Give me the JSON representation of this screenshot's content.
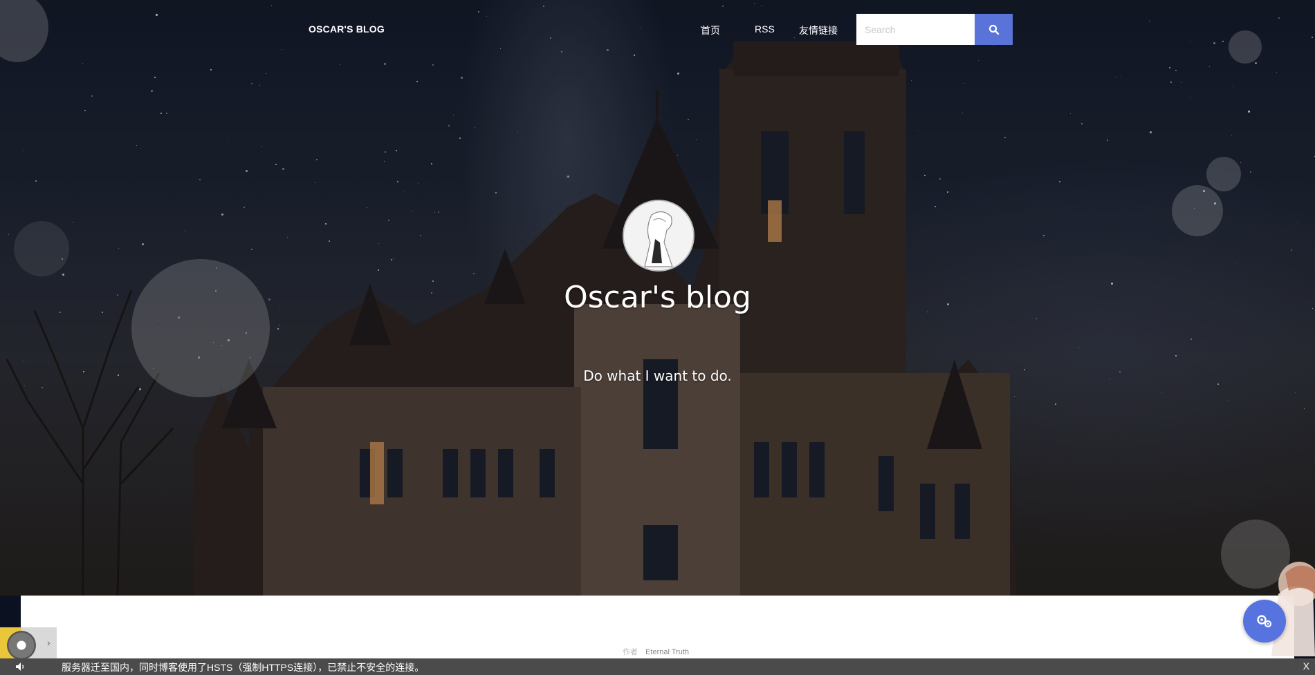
{
  "nav": {
    "brand": "OSCAR'S BLOG",
    "links": [
      {
        "label": "首页"
      },
      {
        "label": "RSS"
      },
      {
        "label": "友情链接"
      }
    ],
    "search": {
      "placeholder": "Search"
    },
    "search_icon": "search-icon",
    "accent_color": "#5a73d8"
  },
  "header": {
    "title": "Oscar's blog",
    "tagline": "Do what I want to do."
  },
  "footer": {
    "author_prefix": "作者",
    "author_name": "Eternal Truth"
  },
  "notice": {
    "text": "服务器迁至国内，同时博客使用了HSTS（强制HTTPS连接），已禁止不安全的连接。",
    "close_label": "X"
  },
  "widgets": {
    "music_arrow": "›",
    "settings_icon": "settings-icon"
  }
}
